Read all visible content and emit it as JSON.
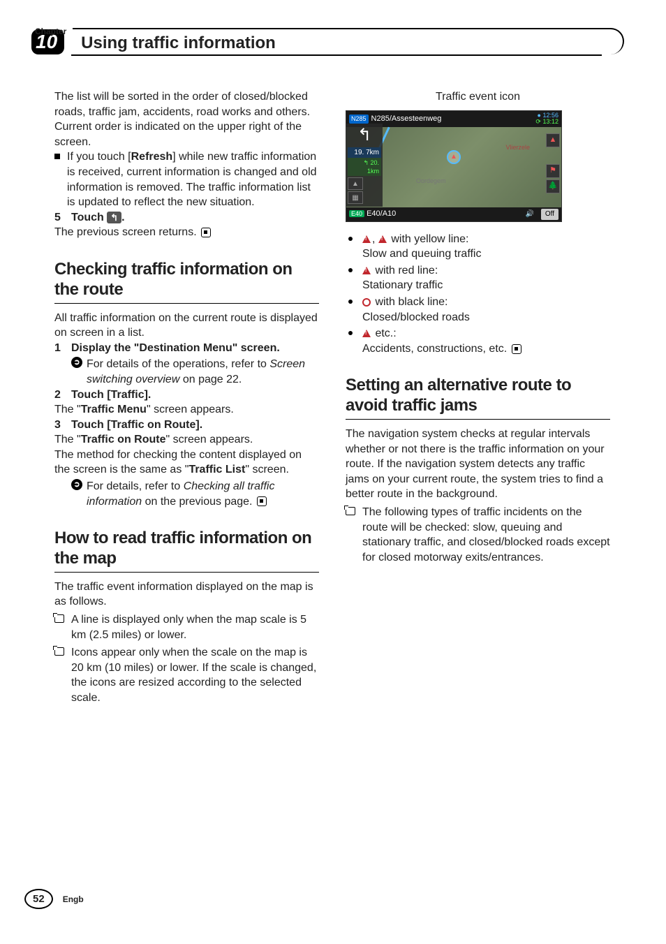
{
  "chapter": {
    "label": "Chapter",
    "number": "10",
    "title": "Using traffic information"
  },
  "col1": {
    "p1": "The list will be sorted in the order of closed/blocked roads, traffic jam, accidents, road works and others.",
    "p2": "Current order is indicated on the upper right of the screen.",
    "p3a": "If you touch [",
    "p3bold": "Refresh",
    "p3b": "] while new traffic information is received, current information is changed and old information is removed. The traffic information list is updated to reflect the new situation.",
    "step5": {
      "num": "5",
      "label": "Touch ",
      "btn": "↰",
      "dot": "."
    },
    "step5_body": "The previous screen returns.",
    "h1": "Checking traffic information on the route",
    "h1_body": "All traffic information on the current route is displayed on screen in a list.",
    "s1": {
      "num": "1",
      "label": "Display the \"Destination Menu\" screen."
    },
    "s1_refer_a": "For details of the operations, refer to ",
    "s1_refer_i": "Screen switching overview",
    "s1_refer_b": " on page 22.",
    "s2": {
      "num": "2",
      "label": "Touch [Traffic]."
    },
    "s2_body_a": "The \"",
    "s2_body_bold": "Traffic Menu",
    "s2_body_b": "\" screen appears.",
    "s3": {
      "num": "3",
      "label": "Touch [Traffic on Route]."
    },
    "s3_body1_a": "The \"",
    "s3_body1_bold": "Traffic on Route",
    "s3_body1_b": "\" screen appears.",
    "s3_body2_a": "The method for checking the content displayed on the screen is the same as \"",
    "s3_body2_bold": "Traffic List",
    "s3_body2_b": "\" screen.",
    "s3_refer_a": "For details, refer to ",
    "s3_refer_i": "Checking all traffic information",
    "s3_refer_b": " on the previous page.",
    "h2": "How to read traffic information on the map",
    "h2_body": "The traffic event information displayed on the map is as follows.",
    "n1": "A line is displayed only when the map scale is 5 km (2.5 miles) or lower.",
    "n2": "Icons appear only when the scale on the map is 20 km (10 miles) or lower. If the scale is changed, the icons are resized according to the selected scale."
  },
  "col2": {
    "caption": "Traffic event icon",
    "screenshot": {
      "top_badge": "N285",
      "top_text": "N285/Assesteenweg",
      "time1": "12:56",
      "time2": "13:12",
      "dist1": "19. 7km",
      "dist2": "20. 1km",
      "bottom_badge": "E40",
      "bottom_text": "E40/A10",
      "off": "Off",
      "place1": "Vlierzele",
      "place2": "Oordegem"
    },
    "b1a": " with yellow line:",
    "b1b": "Slow and queuing traffic",
    "b2a": " with red line:",
    "b2b": "Stationary traffic",
    "b3a": " with black line:",
    "b3b": "Closed/blocked roads",
    "b4a": " etc.:",
    "b4b": "Accidents, constructions, etc.",
    "h3": "Setting an alternative route to avoid traffic jams",
    "h3_body": "The navigation system checks at regular intervals whether or not there is the traffic information on your route. If the navigation system detects any traffic jams on your current route, the system tries to find a better route in the background.",
    "n1": "The following types of traffic incidents on the route will be checked: slow, queuing and stationary traffic, and closed/blocked roads except for closed motorway exits/entrances."
  },
  "footer": {
    "page": "52",
    "lang": "Engb"
  }
}
